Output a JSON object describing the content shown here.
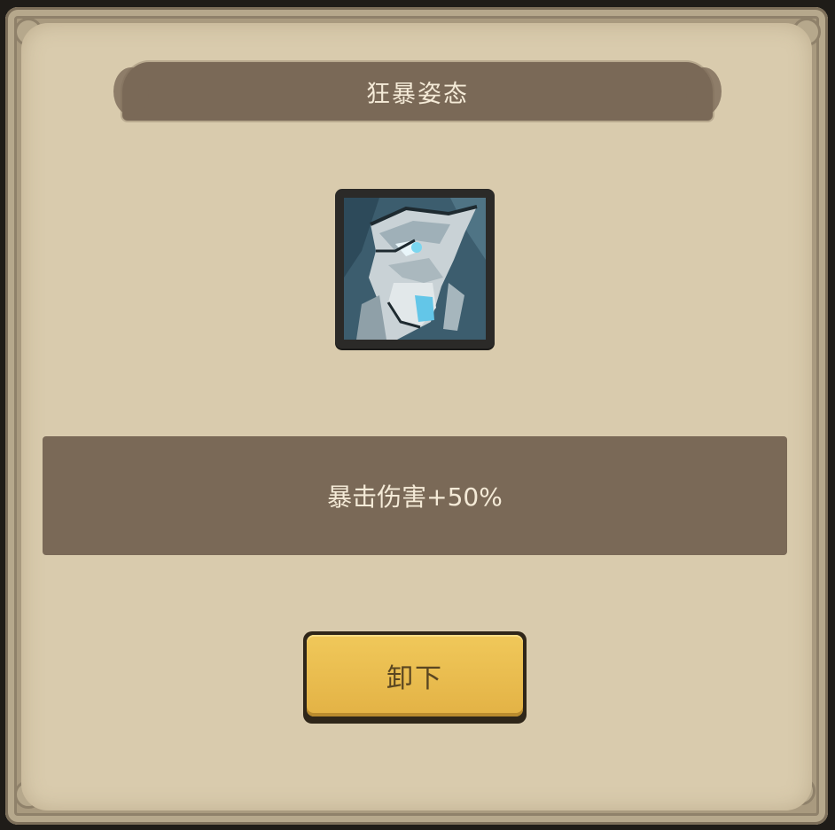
{
  "dialog": {
    "title": "狂暴姿态",
    "skill_icon": "berserker-warrior-portrait-icon",
    "description": "暴击伤害+50%",
    "unequip_label": "卸下"
  },
  "colors": {
    "panel": "#d9cbad",
    "banner": "#7a6957",
    "button": "#e3b245",
    "text_light": "#f4ead7"
  }
}
